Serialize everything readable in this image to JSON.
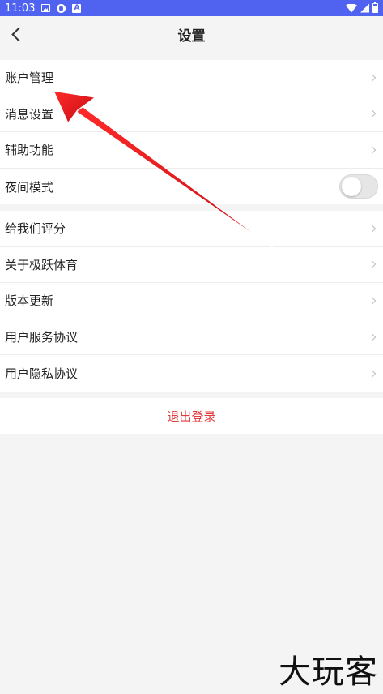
{
  "status_bar": {
    "time": "11:03",
    "left_icons": [
      "image-icon",
      "circle-app-icon",
      "a-app-icon"
    ],
    "right_icons": [
      "wifi-icon",
      "signal-icon",
      "battery-icon"
    ],
    "background": "#4f63f0"
  },
  "nav": {
    "title": "设置",
    "back_icon": "chevron-left-icon"
  },
  "group1": {
    "items": [
      {
        "label": "账户管理",
        "control": "chevron"
      },
      {
        "label": "消息设置",
        "control": "chevron"
      },
      {
        "label": "辅助功能",
        "control": "chevron"
      },
      {
        "label": "夜间模式",
        "control": "toggle",
        "toggle_on": false
      }
    ]
  },
  "group2": {
    "items": [
      {
        "label": "给我们评分",
        "control": "chevron"
      },
      {
        "label": "关于极跃体育",
        "control": "chevron"
      },
      {
        "label": "版本更新",
        "control": "chevron"
      },
      {
        "label": "用户服务协议",
        "control": "chevron"
      },
      {
        "label": "用户隐私协议",
        "control": "chevron"
      }
    ]
  },
  "logout": {
    "label": "退出登录",
    "color": "#e23b3b"
  },
  "annotation": {
    "type": "red-arrow",
    "points_to": "账户管理",
    "color": "#e8141a"
  },
  "watermark": {
    "text": "大玩客"
  }
}
